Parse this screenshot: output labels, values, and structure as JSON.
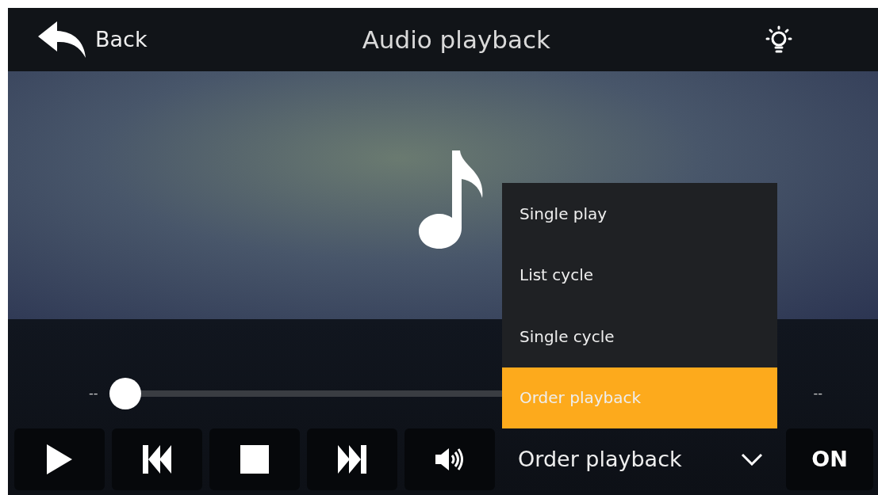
{
  "header": {
    "back_label": "Back",
    "title": "Audio playback"
  },
  "progress": {
    "elapsed": "--",
    "total": "--",
    "level": 0
  },
  "controls": {
    "mode": "Order playback",
    "power": "ON"
  },
  "mode_menu": {
    "expanded": true,
    "options": [
      {
        "label": "Single play",
        "selected": false
      },
      {
        "label": "List cycle",
        "selected": false
      },
      {
        "label": "Single cycle",
        "selected": false
      },
      {
        "label": "Order playback",
        "selected": true
      }
    ]
  }
}
